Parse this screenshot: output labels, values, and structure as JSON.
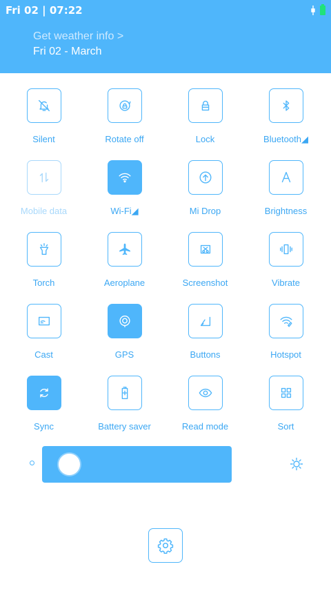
{
  "status": {
    "datetime": "Fri 02 | 07:22"
  },
  "header": {
    "weather_link": "Get weather info >",
    "date": "Fri 02 - March"
  },
  "tiles": [
    {
      "label": "Silent",
      "icon": "bell-off-icon",
      "state": "off"
    },
    {
      "label": "Rotate off",
      "icon": "rotate-lock-icon",
      "state": "off"
    },
    {
      "label": "Lock",
      "icon": "lock-icon",
      "state": "off"
    },
    {
      "label": "Bluetooth◢",
      "icon": "bluetooth-icon",
      "state": "off"
    },
    {
      "label": "Mobile data",
      "icon": "mobile-data-icon",
      "state": "disabled"
    },
    {
      "label": "Wi-Fi◢",
      "icon": "wifi-icon",
      "state": "on"
    },
    {
      "label": "Mi Drop",
      "icon": "upload-icon",
      "state": "off"
    },
    {
      "label": "Brightness",
      "icon": "brightness-auto-icon",
      "state": "off"
    },
    {
      "label": "Torch",
      "icon": "torch-icon",
      "state": "off"
    },
    {
      "label": "Aeroplane",
      "icon": "airplane-icon",
      "state": "off"
    },
    {
      "label": "Screenshot",
      "icon": "scissors-icon",
      "state": "off"
    },
    {
      "label": "Vibrate",
      "icon": "vibrate-icon",
      "state": "off"
    },
    {
      "label": "Cast",
      "icon": "cast-icon",
      "state": "off"
    },
    {
      "label": "GPS",
      "icon": "gps-icon",
      "state": "on"
    },
    {
      "label": "Buttons",
      "icon": "buttons-icon",
      "state": "off"
    },
    {
      "label": "Hotspot",
      "icon": "hotspot-icon",
      "state": "off"
    },
    {
      "label": "Sync",
      "icon": "sync-icon",
      "state": "on"
    },
    {
      "label": "Battery saver",
      "icon": "battery-saver-icon",
      "state": "off"
    },
    {
      "label": "Read mode",
      "icon": "eye-icon",
      "state": "off"
    },
    {
      "label": "Sort",
      "icon": "grid-icon",
      "state": "off"
    }
  ],
  "brightness": {
    "level": 0.06
  },
  "colors": {
    "accent": "#4fb6fb",
    "disabled": "#a8d8fb",
    "battery": "#20e27a"
  }
}
